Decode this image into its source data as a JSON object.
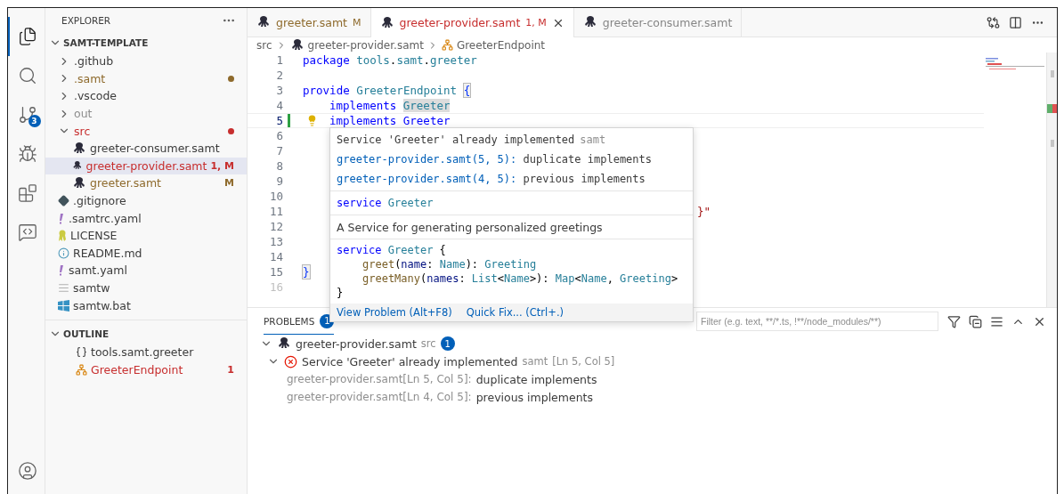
{
  "activity_bar": {
    "items": [
      {
        "kind": "files",
        "selected": true
      },
      {
        "kind": "search",
        "selected": false
      },
      {
        "kind": "source-control",
        "selected": false,
        "badge": "3"
      },
      {
        "kind": "debug",
        "selected": false
      },
      {
        "kind": "extensions",
        "selected": false
      },
      {
        "kind": "remote",
        "selected": false
      }
    ],
    "account": {
      "kind": "account"
    }
  },
  "sidebar": {
    "title": "EXPLORER",
    "workspace": {
      "label": "SAMT-TEMPLATE",
      "expanded": true
    },
    "items": [
      {
        "label": ".github",
        "kind": "folder",
        "expanded": false,
        "color": "#3b3b3b"
      },
      {
        "label": ".samt",
        "kind": "folder",
        "expanded": false,
        "color": "#8e6a2c",
        "dot": true
      },
      {
        "label": ".vscode",
        "kind": "folder",
        "expanded": false,
        "color": "#3b3b3b"
      },
      {
        "label": "out",
        "kind": "folder",
        "expanded": false,
        "color": "#8e8e8e"
      },
      {
        "label": "src",
        "kind": "folder",
        "expanded": true,
        "color": "#c72e2e",
        "dot": true,
        "children": [
          {
            "label": "greeter-consumer.samt",
            "kind": "samt",
            "color": "#3b3b3b",
            "selected": false
          },
          {
            "label": "greeter-provider.samt",
            "kind": "samt",
            "color": "#c72e2e",
            "badge": "1, M",
            "selected": true
          },
          {
            "label": "greeter.samt",
            "kind": "samt",
            "color": "#8e6a2c",
            "badge": "M",
            "selected": false
          }
        ]
      },
      {
        "label": ".gitignore",
        "kind": "git",
        "color": "#3b3b3b"
      },
      {
        "label": ".samtrc.yaml",
        "kind": "yaml",
        "color": "#3b3b3b"
      },
      {
        "label": "LICENSE",
        "kind": "license",
        "color": "#3b3b3b"
      },
      {
        "label": "README.md",
        "kind": "info",
        "color": "#3b3b3b"
      },
      {
        "label": "samt.yaml",
        "kind": "yaml",
        "color": "#3b3b3b"
      },
      {
        "label": "samtw",
        "kind": "text",
        "color": "#3b3b3b"
      },
      {
        "label": "samtw.bat",
        "kind": "windows",
        "color": "#3b3b3b"
      }
    ],
    "outline": {
      "title": "OUTLINE",
      "expanded": true,
      "items": [
        {
          "label": "tools.samt.greeter",
          "kind": "package",
          "color": "#3b3b3b"
        },
        {
          "label": "GreeterEndpoint",
          "kind": "provider",
          "color": "#c72e2e",
          "badge": "1"
        }
      ]
    }
  },
  "editor": {
    "tabs": [
      {
        "label": "greeter.samt",
        "badge": "M",
        "color": "#8e6a2c",
        "selected": false
      },
      {
        "label": "greeter-provider.samt",
        "badge": "1, M",
        "color": "#c72e2e",
        "selected": true
      },
      {
        "label": "greeter-consumer.samt",
        "color": "#868686",
        "selected": false
      }
    ],
    "breadcrumb": [
      {
        "label": "src",
        "kind": "folder"
      },
      {
        "label": "greeter-provider.samt",
        "kind": "samt"
      },
      {
        "label": "GreeterEndpoint",
        "kind": "provider"
      }
    ],
    "lines": [
      {
        "num": "1",
        "tokens": [
          {
            "text": "package ",
            "kind": "keyword"
          },
          {
            "text": "tools",
            "kind": "type"
          },
          {
            "text": "."
          },
          {
            "text": "samt",
            "kind": "type"
          },
          {
            "text": "."
          },
          {
            "text": "greeter",
            "kind": "type"
          }
        ]
      },
      {
        "num": "2"
      },
      {
        "num": "3",
        "tokens": [
          {
            "text": "provide ",
            "kind": "keyword"
          },
          {
            "text": "GreeterEndpoint ",
            "kind": "type"
          },
          {
            "text": "{",
            "kind": "bracket"
          }
        ]
      },
      {
        "num": "4",
        "indented": true,
        "tokens": [
          {
            "text": "implements ",
            "kind": "keyword"
          },
          {
            "text": "Greeter",
            "kind": "type",
            "highlight": true
          }
        ]
      },
      {
        "num": "5",
        "indented": true,
        "active": true,
        "modified": true,
        "lightbulb": true,
        "tokens": [
          {
            "text": "implements ",
            "kind": "keyword",
            "error": true
          },
          {
            "text": "Greeter",
            "kind": "keyword",
            "error": true
          }
        ]
      },
      {
        "num": "6"
      },
      {
        "num": "7"
      },
      {
        "num": "8"
      },
      {
        "num": "9"
      },
      {
        "num": "10"
      },
      {
        "num": "11",
        "partial": true,
        "tokens": [
          {
            "text": "}\"",
            "kind": "string"
          }
        ]
      },
      {
        "num": "12"
      },
      {
        "num": "13"
      },
      {
        "num": "14"
      },
      {
        "num": "15",
        "tokens": [
          {
            "text": "}",
            "kind": "bracket"
          }
        ]
      },
      {
        "num": "16",
        "dim": true
      }
    ],
    "hover": {
      "message": "Service 'Greeter' already implemented",
      "source": "samt",
      "related": [
        {
          "location": "greeter-provider.samt(5, 5):",
          "text": "duplicate implements"
        },
        {
          "location": "greeter-provider.samt(4, 5):",
          "text": "previous implements"
        }
      ],
      "signature": [
        {
          "text": "service ",
          "kind": "keyword"
        },
        {
          "text": "Greeter",
          "kind": "type"
        }
      ],
      "description": "A Service for generating personalized greetings",
      "code": [
        {
          "tokens": [
            {
              "text": "service ",
              "kind": "keyword"
            },
            {
              "text": "Greeter",
              "kind": "type"
            },
            {
              "text": " {"
            }
          ]
        },
        {
          "indented": true,
          "tokens": [
            {
              "text": "greet",
              "kind": "method"
            },
            {
              "text": "("
            },
            {
              "text": "name",
              "kind": "param"
            },
            {
              "text": ": "
            },
            {
              "text": "Name",
              "kind": "type"
            },
            {
              "text": "): "
            },
            {
              "text": "Greeting",
              "kind": "type"
            }
          ]
        },
        {
          "indented": true,
          "tokens": [
            {
              "text": "greetMany",
              "kind": "method"
            },
            {
              "text": "("
            },
            {
              "text": "names",
              "kind": "param"
            },
            {
              "text": ": "
            },
            {
              "text": "List",
              "kind": "type"
            },
            {
              "text": "<"
            },
            {
              "text": "Name",
              "kind": "type"
            },
            {
              "text": ">): "
            },
            {
              "text": "Map",
              "kind": "type"
            },
            {
              "text": "<"
            },
            {
              "text": "Name",
              "kind": "type"
            },
            {
              "text": ", "
            },
            {
              "text": "Greeting",
              "kind": "type"
            },
            {
              "text": ">"
            }
          ]
        },
        {
          "tokens": [
            {
              "text": "}"
            }
          ]
        }
      ],
      "actions": [
        "View Problem (Alt+F8)",
        "Quick Fix... (Ctrl+.)"
      ]
    }
  },
  "panel": {
    "tabs": [
      {
        "label": "PROBLEMS",
        "badge": "1",
        "selected": true
      }
    ],
    "filter": {
      "placeholder": "Filter (e.g. text, **/*.ts, !**/node_modules/**)"
    },
    "files": [
      {
        "label": "greeter-provider.samt",
        "path": "src",
        "count": "1",
        "expanded": true,
        "problems": [
          {
            "kind": "error",
            "message": "Service 'Greeter' already implemented",
            "source": "samt",
            "position": "[Ln 5, Col 5]",
            "expanded": true,
            "related": [
              {
                "location": "greeter-provider.samt[Ln 5, Col 5]:",
                "text": "duplicate implements"
              },
              {
                "location": "greeter-provider.samt[Ln 4, Col 5]:",
                "text": "previous implements"
              }
            ]
          }
        ]
      }
    ]
  }
}
